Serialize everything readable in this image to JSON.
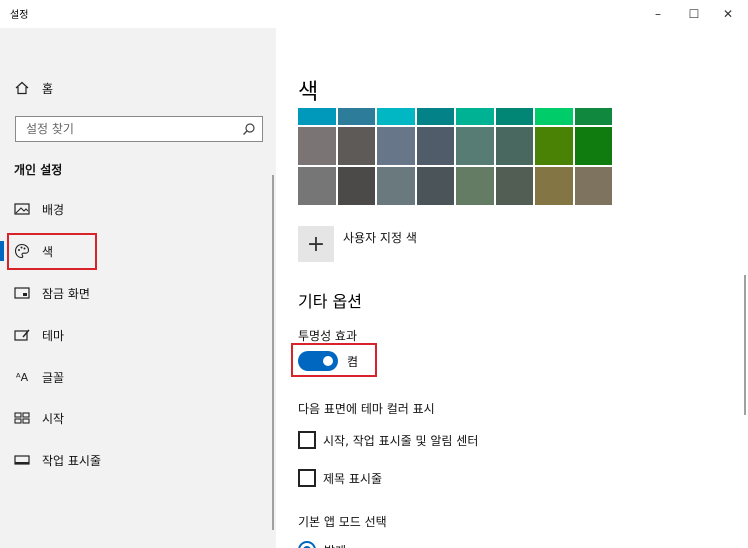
{
  "window": {
    "title": "설정",
    "minimize_glyph": "–",
    "maximize_glyph": "☐",
    "close_glyph": "✕"
  },
  "sidebar": {
    "home_label": "홈",
    "home_icon": "home-icon",
    "search": {
      "placeholder": "설정 찾기",
      "value": ""
    },
    "section_title": "개인 설정",
    "items": [
      {
        "label": "배경",
        "icon": "background-icon"
      },
      {
        "label": "색",
        "icon": "palette-icon",
        "selected": true
      },
      {
        "label": "잠금 화면",
        "icon": "lock-screen-icon"
      },
      {
        "label": "테마",
        "icon": "theme-icon"
      },
      {
        "label": "글꼴",
        "icon": "fonts-icon"
      },
      {
        "label": "시작",
        "icon": "start-icon"
      },
      {
        "label": "작업 표시줄",
        "icon": "taskbar-icon"
      }
    ]
  },
  "content": {
    "heading": "색",
    "swatch_rows": [
      [
        "#0099bc",
        "#2d7d9a",
        "#00b7c3",
        "#038387",
        "#00b294",
        "#018574",
        "#00cc6a",
        "#10893e"
      ],
      [
        "#7a7574",
        "#5d5a58",
        "#68768a",
        "#515c6b",
        "#567c73",
        "#486860",
        "#498205",
        "#107c10"
      ],
      [
        "#767676",
        "#4c4a48",
        "#69797e",
        "#4a5459",
        "#647c64",
        "#525e54",
        "#847545",
        "#7e735f"
      ]
    ],
    "custom_color": {
      "plus": "+",
      "label": "사용자 지정 색"
    },
    "more_options_heading": "기타 옵션",
    "transparency": {
      "label": "투명성 효과",
      "state": "켬",
      "on": true
    },
    "surfaces": {
      "label": "다음 표면에 테마 컬러 표시",
      "options": [
        {
          "label": "시작, 작업 표시줄 및 알림 센터",
          "checked": false
        },
        {
          "label": "제목 표시줄",
          "checked": false
        }
      ]
    },
    "app_mode": {
      "label": "기본 앱 모드 선택",
      "first_option": "밝게"
    }
  },
  "colors": {
    "accent": "#0067c0",
    "highlight": "#d9232b",
    "sidebar_bg": "#f2f2f2"
  }
}
